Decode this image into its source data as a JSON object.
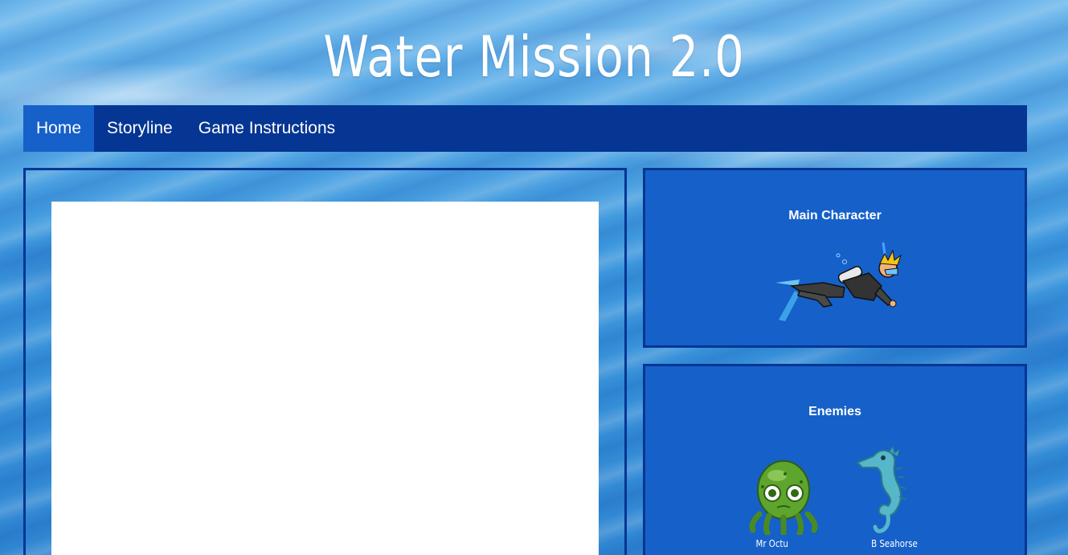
{
  "site": {
    "title": "Water Mission 2.0"
  },
  "nav": {
    "items": [
      {
        "label": "Home",
        "active": true
      },
      {
        "label": "Storyline",
        "active": false
      },
      {
        "label": "Game Instructions",
        "active": false
      }
    ]
  },
  "sidebar": {
    "main_character": {
      "title": "Main Character",
      "icon": "scuba-diver-icon"
    },
    "enemies": {
      "title": "Enemies",
      "items": [
        {
          "name": "Mr Octu",
          "icon": "octopus-icon"
        },
        {
          "name": "B Seahorse",
          "icon": "seahorse-icon"
        }
      ]
    }
  },
  "colors": {
    "nav_bg": "#053694",
    "nav_active": "#1660c9",
    "panel_bg": "#1660c9",
    "panel_border": "#053694",
    "canvas_bg": "#ffffff"
  }
}
